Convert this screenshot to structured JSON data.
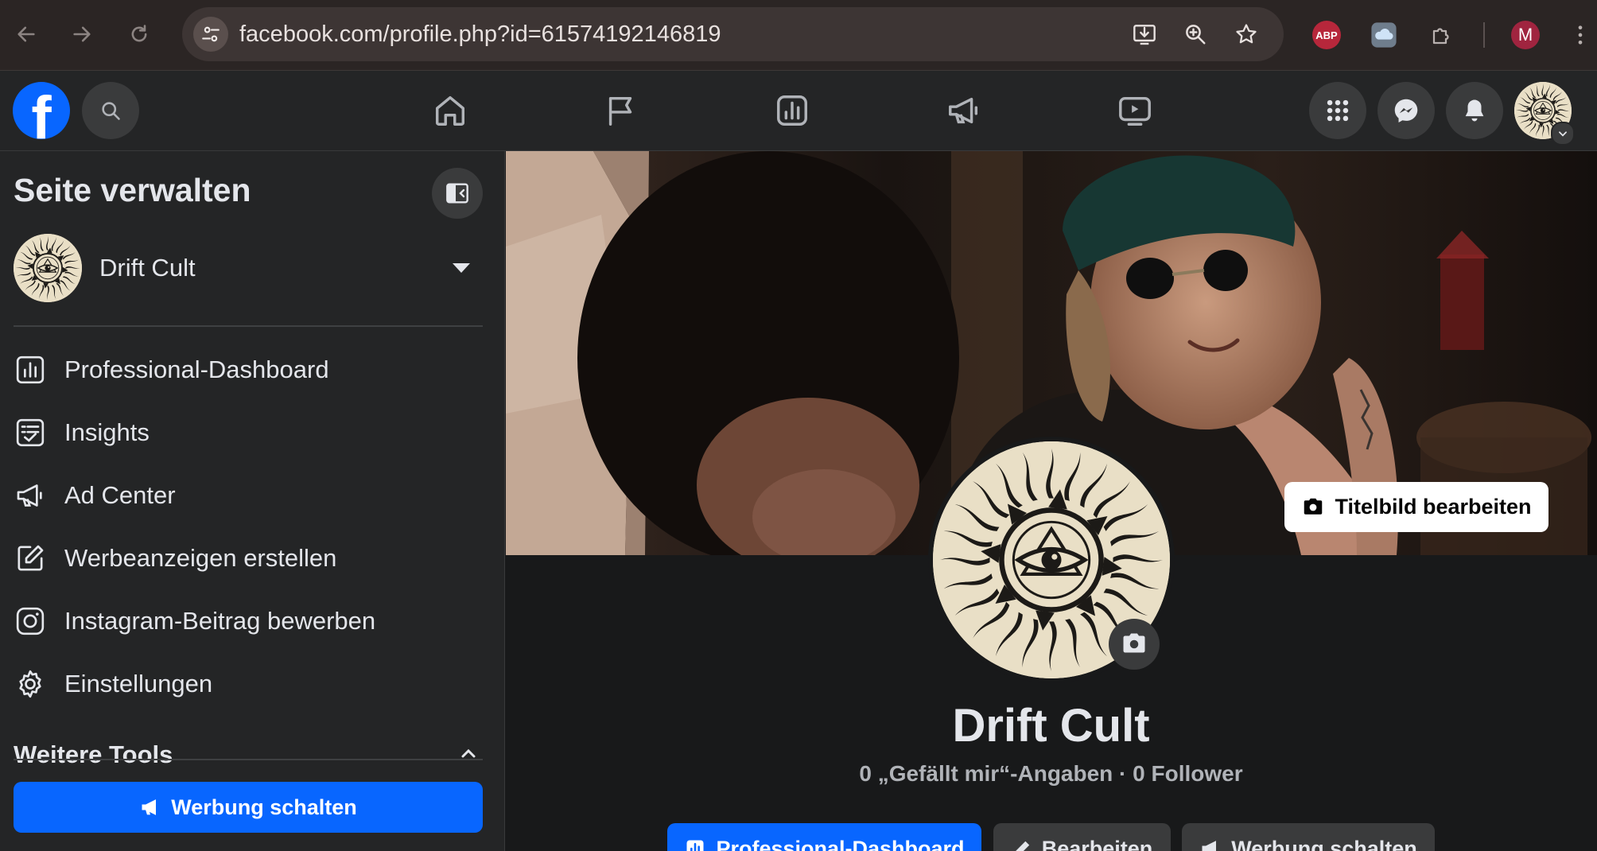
{
  "browser": {
    "url": "facebook.com/profile.php?id=61574192146819",
    "extensions": {
      "abp_label": "ABP"
    },
    "profile_initial": "M"
  },
  "sidebar": {
    "title": "Seite verwalten",
    "page_name": "Drift Cult",
    "items": [
      {
        "label": "Professional-Dashboard",
        "icon": "dashboard-icon"
      },
      {
        "label": "Insights",
        "icon": "insights-icon"
      },
      {
        "label": "Ad Center",
        "icon": "megaphone-icon"
      },
      {
        "label": "Werbeanzeigen erstellen",
        "icon": "edit-icon"
      },
      {
        "label": "Instagram-Beitrag bewerben",
        "icon": "instagram-icon"
      },
      {
        "label": "Einstellungen",
        "icon": "gear-icon"
      }
    ],
    "tools_header": "Weitere Tools",
    "ad_button": "Werbung schalten"
  },
  "profile": {
    "cover_edit_label": "Titelbild bearbeiten",
    "name": "Drift Cult",
    "stats": "0 „Gefällt mir“-Angaben · 0 Follower",
    "actions": {
      "dashboard": "Professional-Dashboard",
      "edit": "Bearbeiten",
      "promote": "Werbung schalten"
    }
  },
  "colors": {
    "accent": "#0866ff",
    "background": "#18191a",
    "surface": "#242526"
  }
}
